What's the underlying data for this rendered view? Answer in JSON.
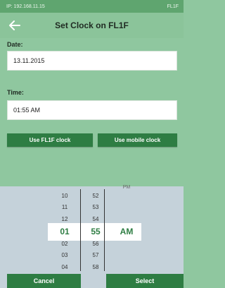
{
  "status": {
    "ip": "IP: 192.168.11.15",
    "device": "FL1F"
  },
  "header": {
    "title": "Set Clock on FL1F"
  },
  "date": {
    "label": "Date:",
    "value": "13.11.2015"
  },
  "time": {
    "label": "Time:",
    "value": "01:55 AM"
  },
  "actions": {
    "use_device_clock": "Use FL1F clock",
    "use_mobile_clock": "Use mobile clock"
  },
  "picker": {
    "hours": [
      "10",
      "11",
      "12",
      "01",
      "02",
      "03",
      "04"
    ],
    "minutes": [
      "52",
      "53",
      "54",
      "55",
      "56",
      "57",
      "58"
    ],
    "period_top": "PM",
    "period_selected": "AM",
    "selected_hour": "01",
    "selected_minute": "55"
  },
  "footer": {
    "cancel": "Cancel",
    "select": "Select"
  },
  "colors": {
    "accent": "#2e7d43",
    "background": "#8fc79f",
    "picker_bg": "#c5d2da"
  }
}
